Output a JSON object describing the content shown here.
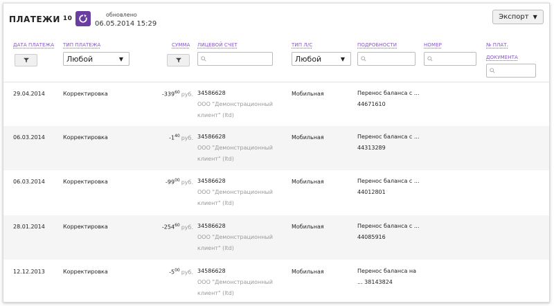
{
  "header": {
    "title": "ПЛАТЕЖИ",
    "count": "10",
    "updated_label": "обновлено",
    "updated_time": "06.05.2014 15:29",
    "export_label": "Экспорт"
  },
  "columns": {
    "date": "ДАТА ПЛАТЕЖА",
    "type": "ТИП ПЛАТЕЖА",
    "sum": "СУММА",
    "account": "ЛИЦЕВОЙ СЧЕТ",
    "account_type": "ТИП Л/С",
    "details": "ПОДРОБНОСТИ",
    "number": "НОМЕР",
    "doc_number_1": "№ ПЛАТ.",
    "doc_number_2": "ДОКУМЕНТА"
  },
  "filters": {
    "type_value": "Любой",
    "account_type_value": "Любой"
  },
  "rows": [
    {
      "date": "29.04.2014",
      "type": "Корректировка",
      "amount_int": "-339",
      "amount_frac": "60",
      "currency": "руб.",
      "account": "34586628",
      "client_1": "ООО \"Демонстрационный",
      "client_2": "клиент\" (ltd)",
      "account_type": "Мобильная",
      "details_1": "Перенос баланса с ...",
      "details_2": "44671610"
    },
    {
      "date": "06.03.2014",
      "type": "Корректировка",
      "amount_int": "-1",
      "amount_frac": "40",
      "currency": "руб.",
      "account": "34586628",
      "client_1": "ООО \"Демонстрационный",
      "client_2": "клиент\" (ltd)",
      "account_type": "Мобильная",
      "details_1": "Перенос баланса с ...",
      "details_2": "44313289"
    },
    {
      "date": "06.03.2014",
      "type": "Корректировка",
      "amount_int": "-99",
      "amount_frac": "00",
      "currency": "руб.",
      "account": "34586628",
      "client_1": "ООО \"Демонстрационный",
      "client_2": "клиент\" (ltd)",
      "account_type": "Мобильная",
      "details_1": "Перенос баланса с ...",
      "details_2": "44012801"
    },
    {
      "date": "28.01.2014",
      "type": "Корректировка",
      "amount_int": "-254",
      "amount_frac": "60",
      "currency": "руб.",
      "account": "34586628",
      "client_1": "ООО \"Демонстрационный",
      "client_2": "клиент\" (ltd)",
      "account_type": "Мобильная",
      "details_1": "Перенос баланса с ...",
      "details_2": "44085916"
    },
    {
      "date": "12.12.2013",
      "type": "Корректировка",
      "amount_int": "-5",
      "amount_frac": "00",
      "currency": "руб.",
      "account": "34586628",
      "client_1": "ООО \"Демонстрационный",
      "client_2": "клиент\" (ltd)",
      "account_type": "Мобильная",
      "details_1": "Перенос баланса на",
      "details_2": "... 38143824"
    }
  ]
}
